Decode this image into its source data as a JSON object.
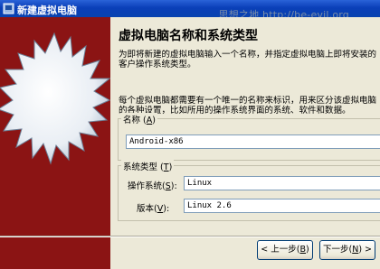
{
  "window": {
    "title": "新建虚拟电脑",
    "watermark": "思想之地 http://be-evil.org"
  },
  "page": {
    "heading": "虚拟电脑名称和系统类型",
    "intro": "为即将新建的虚拟电脑输入一个名称，并指定虚拟电脑上即将安装的客户操作系统类型。",
    "description": "每个虚拟电脑都需要有一个唯一的名称来标识，用来区分该虚拟电脑的各种设置，比如所用的操作系统界面的系统、软件和数据。"
  },
  "name_group": {
    "legend": "名称",
    "mnemonic": "A",
    "value": "Android-x86"
  },
  "os_group": {
    "legend": "系统类型",
    "mnemonic": "T",
    "os_label": "操作系统",
    "os_mnemonic": "S",
    "os_value": "Linux",
    "version_label": "版本",
    "version_mnemonic": "V",
    "version_value": "Linux 2.6"
  },
  "buttons": {
    "back_label": "< 上一步",
    "back_mnemonic": "B",
    "next_label": "下一步",
    "next_mnemonic": "N",
    "next_suffix": ">"
  },
  "colors": {
    "title_bar": "#0a3fb8",
    "side_panel": "#8b1414",
    "dialog_bg": "#ece9d8"
  }
}
